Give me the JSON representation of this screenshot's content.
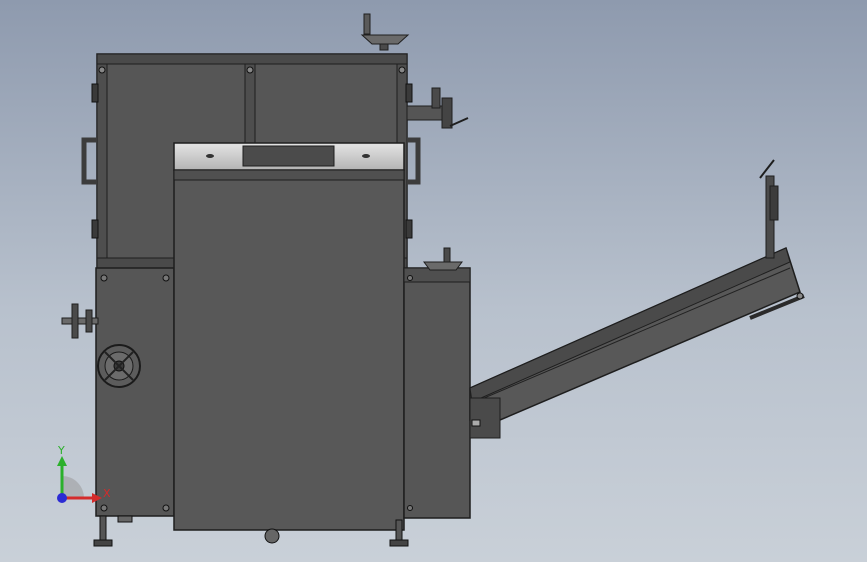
{
  "view": {
    "background_colors": [
      "#8e9aae",
      "#c9d0d8"
    ],
    "model_color": "#555555",
    "panel_color": "#c8c8c8"
  },
  "triad": {
    "x_label": "X",
    "y_label": "Y",
    "x_color": "#d42b2b",
    "y_color": "#2bb02b",
    "z_color": "#2b2bd4"
  }
}
